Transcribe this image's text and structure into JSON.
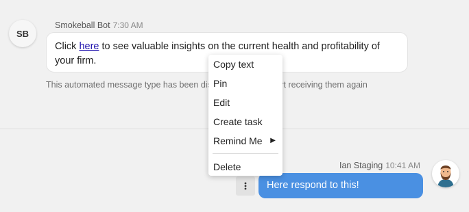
{
  "bot_message": {
    "avatar_initials": "SB",
    "sender": "Smokeball Bot",
    "time": "7:30 AM",
    "text_before": "Click ",
    "link_text": "here",
    "text_after": " to see valuable insights on the current health and profitability of your firm.",
    "notice_part1": "This automated message type has been dis",
    "notice_part2": "to start receiving them again"
  },
  "context_menu": {
    "items": [
      "Copy text",
      "Pin",
      "Edit",
      "Create task",
      "Remind Me",
      "Delete"
    ]
  },
  "user_message": {
    "sender": "Ian Staging",
    "time": "10:41 AM",
    "text": "Here respond to this!",
    "bubble_color": "#4a90e2"
  }
}
